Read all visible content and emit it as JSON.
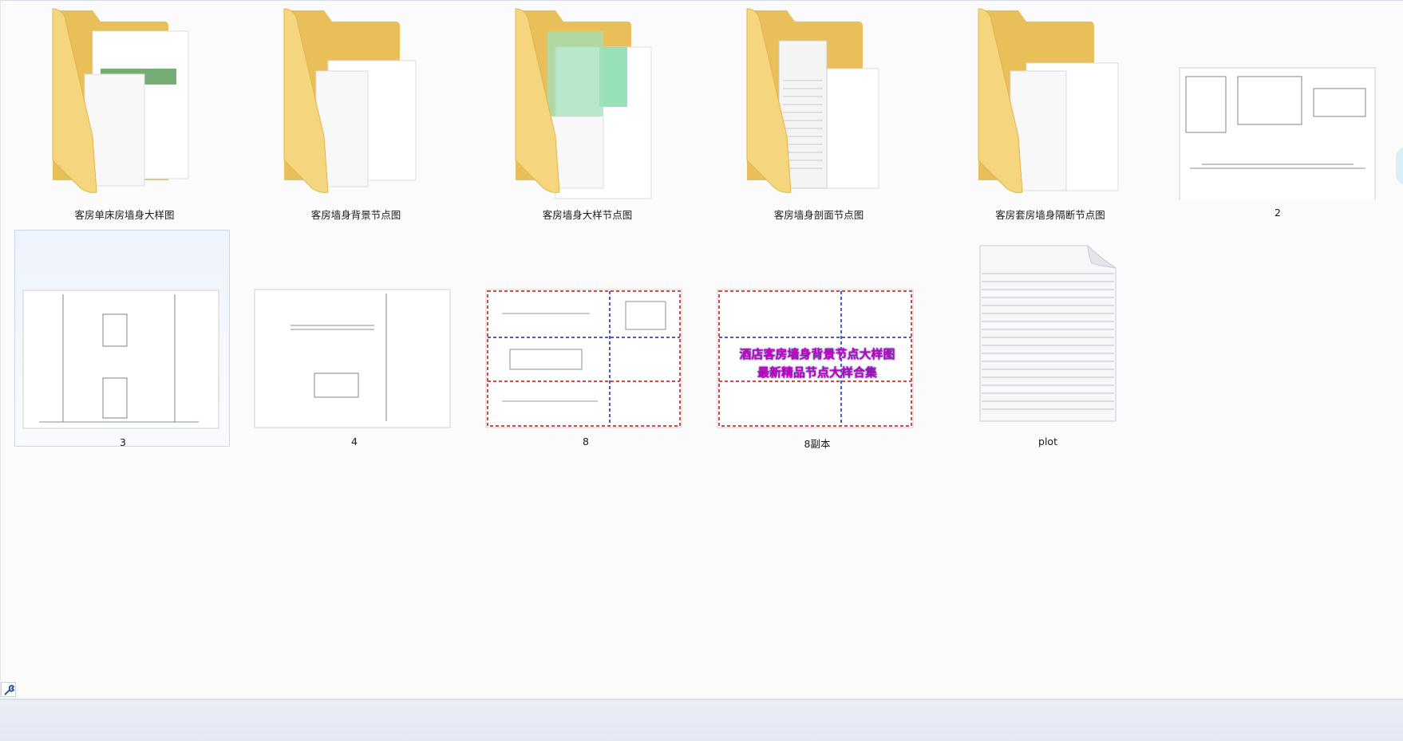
{
  "items": [
    {
      "label": "客房单床房墙身大样图",
      "type": "folder",
      "preview": "green-drawings"
    },
    {
      "label": "客房墙身背景节点图",
      "type": "folder",
      "preview": "line-drawings"
    },
    {
      "label": "客房墙身大样节点图",
      "type": "folder",
      "preview": "green-drawings"
    },
    {
      "label": "客房墙身剖面节点图",
      "type": "folder",
      "preview": "lined-drawings"
    },
    {
      "label": "客房套房墙身隔断节点图",
      "type": "folder",
      "preview": "line-drawings"
    },
    {
      "label": "2",
      "type": "image"
    },
    {
      "label": "3",
      "type": "image",
      "selected": true
    },
    {
      "label": "4",
      "type": "image"
    },
    {
      "label": "8",
      "type": "image"
    },
    {
      "label": "8副本",
      "type": "image"
    },
    {
      "label": "plot",
      "type": "document"
    }
  ],
  "overlay_text": {
    "line1": "酒店客房墙身背景节点大样图",
    "line2": "最新精品节点大样合集"
  },
  "icons": {
    "folder": "folder-icon",
    "image": "image-thumbnail-icon",
    "document": "text-document-icon",
    "tool": "wrench-icon"
  },
  "colors": {
    "folder_body": "#f6d57f",
    "folder_back": "#e8bf59",
    "selection_bg": "#eef4fc",
    "selection_border": "#c7d9ef",
    "status_bar": "#e6ecf4",
    "overlay_text": "#c000c0"
  }
}
